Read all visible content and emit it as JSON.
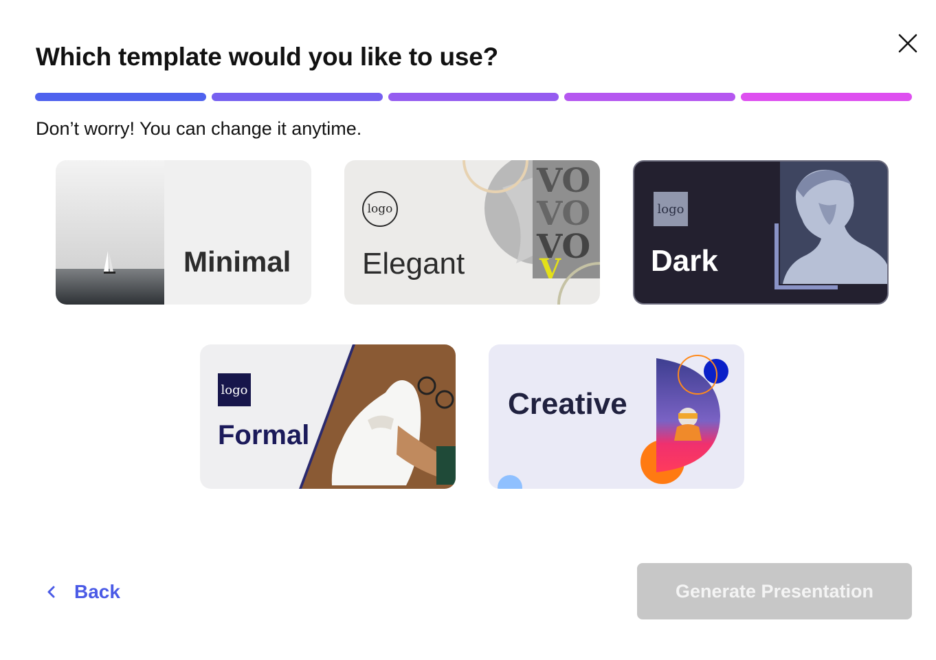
{
  "dialog": {
    "title": "Which template would you like to use?",
    "subtitle": "Don’t worry! You can change it anytime.",
    "close_icon": "close-icon"
  },
  "progress": {
    "steps_total": 5,
    "steps_completed": 5,
    "colors": [
      "#4f62ee",
      "#7660f0",
      "#955cf0",
      "#b557f0",
      "#de4ff0"
    ]
  },
  "templates": [
    {
      "label": "Minimal"
    },
    {
      "label": "Elegant",
      "logo": "logo"
    },
    {
      "label": "Dark",
      "logo": "logo"
    },
    {
      "label": "Formal",
      "logo": "logo"
    },
    {
      "label": "Creative"
    }
  ],
  "footer": {
    "back_label": "Back",
    "generate_label": "Generate Presentation",
    "generate_enabled": false
  },
  "colors": {
    "accent": "#4b5be6",
    "disabled_button": "#c7c7c7"
  }
}
